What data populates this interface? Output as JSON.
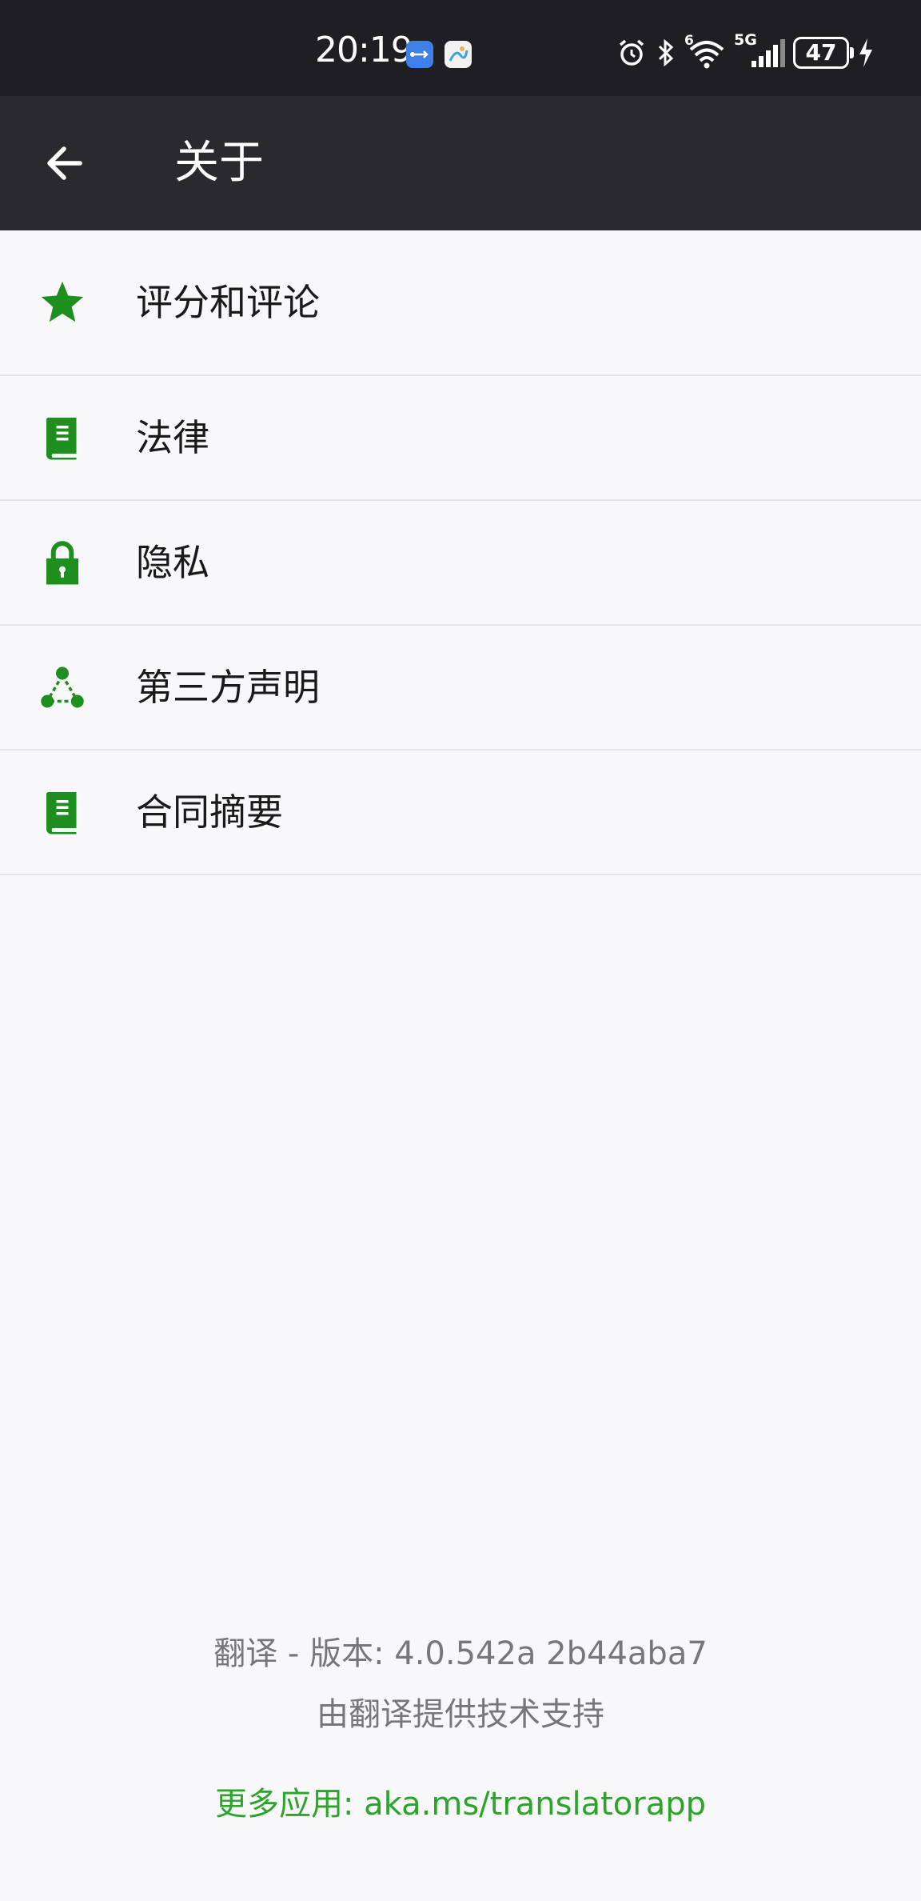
{
  "status_bar": {
    "time": "20:19",
    "network_label": "5G",
    "wifi_badge": "6",
    "battery_level": "47"
  },
  "app_bar": {
    "title": "关于"
  },
  "menu": {
    "items": [
      {
        "label": "评分和评论",
        "icon": "star-icon"
      },
      {
        "label": "法律",
        "icon": "book-icon"
      },
      {
        "label": "隐私",
        "icon": "lock-icon"
      },
      {
        "label": "第三方声明",
        "icon": "share-nodes-icon"
      },
      {
        "label": "合同摘要",
        "icon": "book-icon"
      }
    ]
  },
  "footer": {
    "version": "翻译 - 版本: 4.0.542a 2b44aba7",
    "powered_by": "由翻译提供技术支持",
    "more_apps": "更多应用: aka.ms/translatorapp"
  },
  "colors": {
    "accent": "#1e8e1e",
    "link": "#2aa52a",
    "header": "#2a292e",
    "status_bar": "#1f1e23",
    "background": "#f8f7fa"
  }
}
